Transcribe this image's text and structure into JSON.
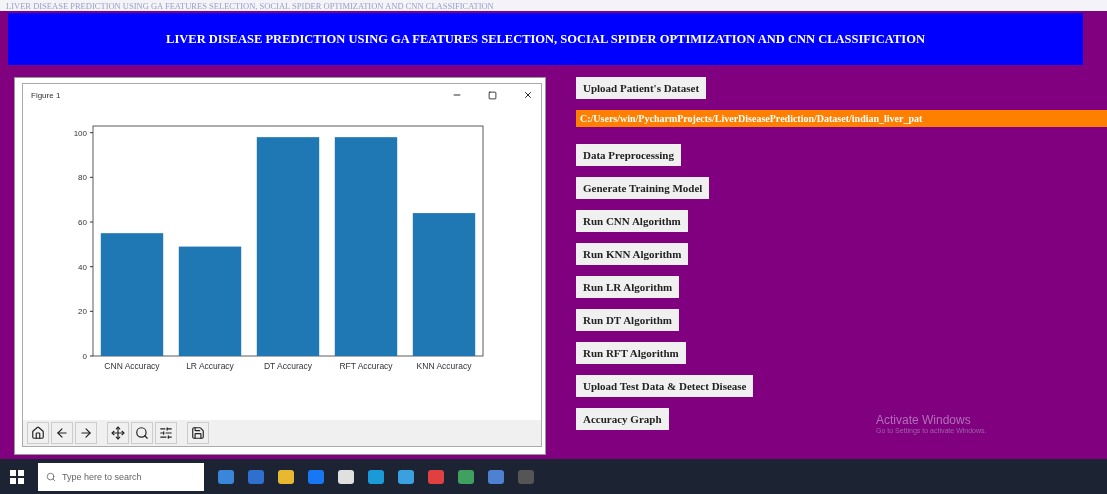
{
  "window": {
    "title": "LIVER DISEASE PREDICTION USING GA FEATURES SELECTION, SOCIAL SPIDER OPTIMIZATION AND CNN CLASSIFICATION"
  },
  "header": {
    "title": "LIVER DISEASE PREDICTION USING GA FEATURES SELECTION, SOCIAL SPIDER OPTIMIZATION AND CNN CLASSIFICATION"
  },
  "figure": {
    "title": "Figure 1",
    "chart_data": {
      "type": "bar",
      "categories": [
        "CNN Accuracy",
        "LR Accuracy",
        "DT Accuracy",
        "RFT Accuracy",
        "KNN Accuracy"
      ],
      "series": [
        {
          "color": "#1f77b4",
          "values": [
            55,
            49,
            98,
            98,
            64
          ]
        }
      ],
      "ylim": [
        0,
        103
      ],
      "yticks": [
        0,
        20,
        40,
        60,
        80,
        100
      ]
    }
  },
  "buttons": [
    {
      "label": "Upload Patient's Dataset"
    },
    {
      "label": "Data Preprocessing"
    },
    {
      "label": "Generate Training Model"
    },
    {
      "label": "Run CNN Algorithm"
    },
    {
      "label": "Run KNN Algorithm"
    },
    {
      "label": "Run LR Algorithm"
    },
    {
      "label": "Run DT Algorithm"
    },
    {
      "label": "Run RFT Algorithm"
    },
    {
      "label": "Upload Test Data & Detect Disease"
    },
    {
      "label": "Accuracy Graph"
    }
  ],
  "path_label": "C:/Users/win/PycharmProjects/LiverDiseasePrediction/Dataset/indian_liver_pat",
  "watermark": {
    "title": "Activate Windows",
    "subtitle": "Go to Settings to activate Windows."
  },
  "taskbar": {
    "search_placeholder": "Type here to search"
  }
}
